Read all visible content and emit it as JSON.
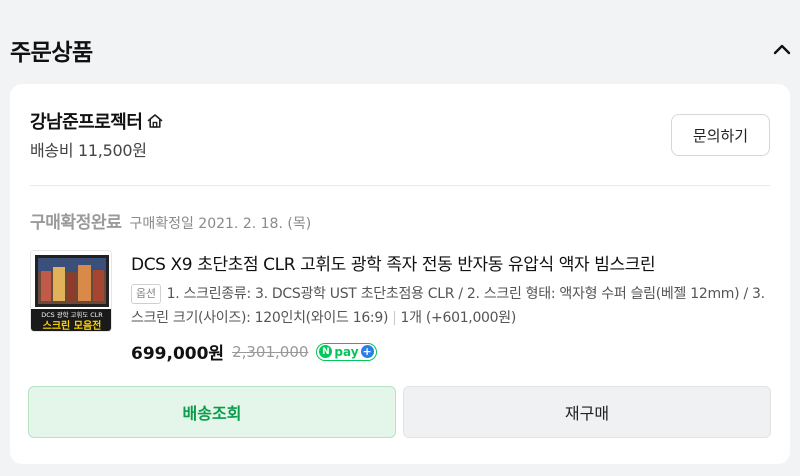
{
  "section": {
    "title": "주문상품"
  },
  "store": {
    "name": "강남준프로젝터",
    "shipping_fee": "배송비 11,500원",
    "inquiry_label": "문의하기"
  },
  "order": {
    "status": "구매확정완료",
    "status_date": "구매확정일 2021. 2. 18. (목)"
  },
  "product": {
    "title": "DCS X9 초단초점 CLR 고휘도 광학 족자 전동 반자동 유압식 액자 빔스크린",
    "option_badge": "옵션",
    "option_text": "1. 스크린종류: 3. DCS광학 UST 초단초점용 CLR / 2. 스크린 형태: 액자형 수퍼 슬림(베젤 12mm) / 3. 스크린 크기(사이즈): 120인치(와이드 16:9)",
    "quantity_text": "1개 (+601,000원)",
    "price": "699,000원",
    "original_price": "2,301,000",
    "npay_label": "pay",
    "thumb_caption_top": "DCS 광학 고휘도 CLR",
    "thumb_caption_bottom": "스크린 모음전"
  },
  "actions": {
    "track_label": "배송조회",
    "reorder_label": "재구매"
  },
  "colors": {
    "accent_green": "#0a9c4a",
    "npay_green": "#03c75a",
    "status_gray": "#9a9a9a"
  },
  "icons": {
    "home": "home-icon",
    "collapse": "chevron-up-icon"
  }
}
